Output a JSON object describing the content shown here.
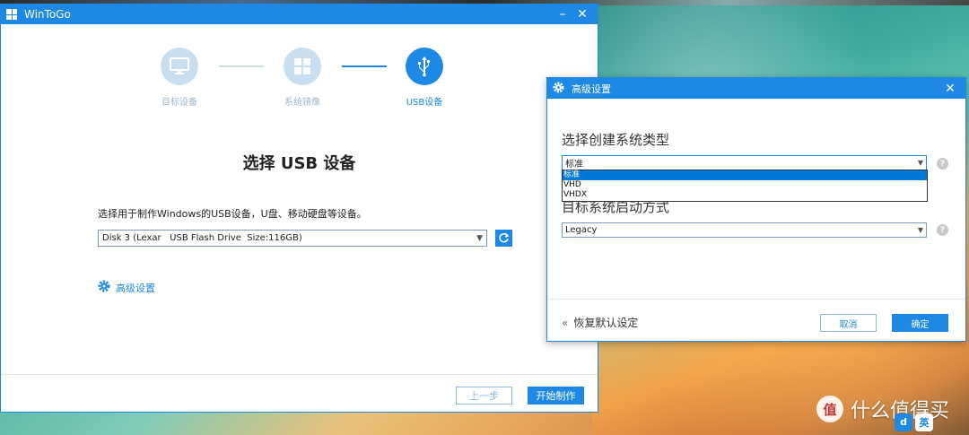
{
  "main_window": {
    "title": "WinToGo",
    "steps": [
      {
        "label": "目标设备",
        "active": false,
        "icon": "monitor-icon"
      },
      {
        "label": "系统镜像",
        "active": false,
        "icon": "windows-icon"
      },
      {
        "label": "USB设备",
        "active": true,
        "icon": "usb-icon"
      }
    ],
    "heading": "选择 USB 设备",
    "description": "选择用于制作Windows的USB设备，U盘、移动硬盘等设备。",
    "disk_select": {
      "value": "Disk 3 (Lexar   USB Flash Drive  Size:116GB)"
    },
    "advanced_link": "高级设置",
    "buttons": {
      "prev": "上一步",
      "start": "开始制作"
    }
  },
  "advanced_dialog": {
    "title": "高级设置",
    "section1_label": "选择创建系统类型",
    "type_select": {
      "value": "标准",
      "options": [
        "标准",
        "VHD",
        "VHDX"
      ],
      "selected_index": 0
    },
    "section2_label": "目标系统启动方式",
    "boot_select": {
      "value": "Legacy"
    },
    "help": "?",
    "reset_label": "恢复默认设定",
    "buttons": {
      "cancel": "取消",
      "ok": "确定"
    }
  },
  "watermark": {
    "logo": "值",
    "text": "什么值得买"
  },
  "ime": {
    "lang": "英",
    "label1": "d"
  },
  "colors": {
    "accent": "#1e88e5",
    "step_inactive": "#c9dff0"
  }
}
